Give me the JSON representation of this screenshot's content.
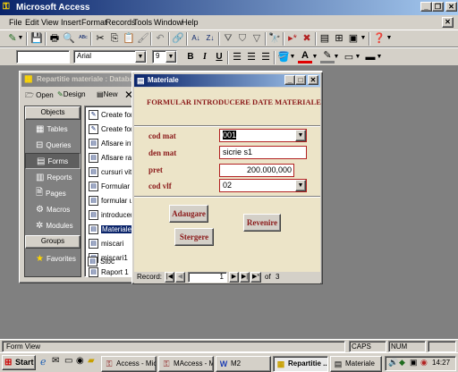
{
  "app": {
    "title": "Microsoft Access",
    "title_icon": "key-icon",
    "menu": [
      "File",
      "Edit",
      "View",
      "Insert",
      "Format",
      "Records",
      "Tools",
      "Window",
      "Help"
    ],
    "font_name": "Arial",
    "font_size": "9",
    "format_buttons": [
      "B",
      "I",
      "U"
    ]
  },
  "db_window": {
    "title": "Repartitie materiale : Database",
    "toolbar": {
      "open": "Open",
      "design": "Design",
      "new": "New"
    },
    "objects_header": "Objects",
    "objects": [
      {
        "label": "Tables",
        "icon": "table-icon"
      },
      {
        "label": "Queries",
        "icon": "query-icon"
      },
      {
        "label": "Forms",
        "icon": "form-icon"
      },
      {
        "label": "Reports",
        "icon": "report-icon"
      },
      {
        "label": "Pages",
        "icon": "page-icon"
      },
      {
        "label": "Macros",
        "icon": "macro-icon"
      },
      {
        "label": "Modules",
        "icon": "module-icon"
      }
    ],
    "groups_header": "Groups",
    "groups": [
      {
        "label": "Favorites",
        "icon": "favorites-icon"
      }
    ],
    "list": [
      "Create for",
      "Create for",
      "Afisare int",
      "Afisare ra",
      "cursuri vit",
      "Formular g",
      "formular u",
      "introducer",
      "Materiale",
      "miscari",
      "miscari1",
      "Raport 1",
      "Stoc"
    ],
    "selected_index": 8
  },
  "form": {
    "title": "Materiale",
    "heading": "FORMULAR INTRODUCERE DATE MATERIALE",
    "fields": [
      {
        "label": "cod mat",
        "value": "001",
        "type": "combo"
      },
      {
        "label": "den mat",
        "value": "sicrie  s1",
        "type": "text"
      },
      {
        "label": "pret",
        "value": "200.000,000",
        "type": "text"
      },
      {
        "label": "cod vlf",
        "value": "02",
        "type": "combo"
      }
    ],
    "buttons": {
      "add": "Adaugare",
      "delete": "Stergere",
      "back": "Revenire"
    },
    "nav": {
      "label": "Record:",
      "current": "1",
      "of_label": "of",
      "total": "3"
    }
  },
  "status": {
    "left": "Form View",
    "caps": "CAPS",
    "num": "NUM"
  },
  "taskbar": {
    "start": "Start",
    "tasks": [
      {
        "label": "Access - Mic...",
        "icon": "access-icon"
      },
      {
        "label": "MAccess - M...",
        "icon": "access-icon"
      },
      {
        "label": "M2",
        "icon": "word-icon"
      },
      {
        "label": "Repartitie ...",
        "icon": "database-icon"
      },
      {
        "label": "Materiale",
        "icon": "form-icon"
      }
    ],
    "active_index": 3,
    "clock": "14:27"
  }
}
